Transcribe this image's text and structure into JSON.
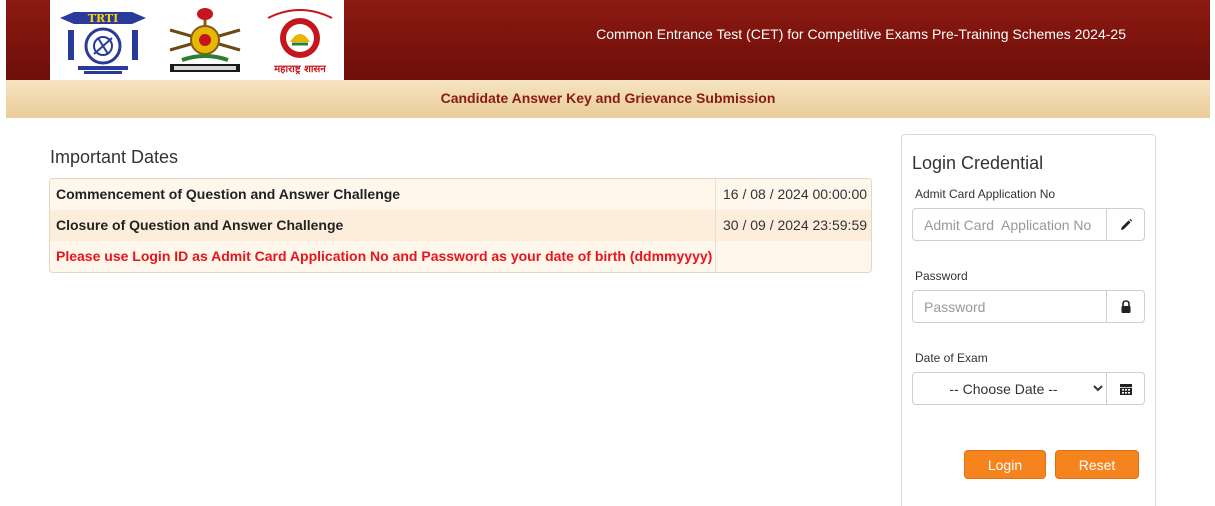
{
  "header": {
    "title": "Common Entrance Test (CET) for Competitive Exams Pre-Training Schemes 2024-25",
    "logos": {
      "trti": {
        "name": "trti-logo",
        "text": "TRTI"
      },
      "emblem": {
        "name": "tribal-emblem-logo"
      },
      "maharashtra": {
        "name": "maharashtra-govt-logo",
        "text": "महाराष्ट्र शासन"
      }
    }
  },
  "subbar": {
    "title": "Candidate Answer Key and Grievance Submission"
  },
  "dates": {
    "heading": "Important Dates",
    "rows": [
      {
        "label": "Commencement of Question and Answer Challenge",
        "value": "16 / 08 / 2024 00:00:00"
      },
      {
        "label": "Closure of Question and Answer Challenge",
        "value": "30 / 09 / 2024 23:59:59"
      }
    ],
    "note": "Please use Login ID as Admit Card Application No and Password as your date of birth (ddmmyyyy)"
  },
  "login": {
    "title": "Login Credential",
    "application_label": "Admit Card Application No",
    "application_placeholder": "Admit Card  Application No",
    "password_label": "Password",
    "password_placeholder": "Password",
    "exam_date_label": "Date of Exam",
    "exam_date_selected": "-- Choose Date --",
    "login_button": "Login",
    "reset_button": "Reset",
    "icons": {
      "application": "pencil-icon",
      "password": "lock-icon",
      "exam_date": "calendar-icon"
    }
  },
  "colors": {
    "header_bg": "#7a120c",
    "subbar_bg": "#efd7ad",
    "subbar_text": "#8b1a12",
    "note_text": "#e8141b",
    "button_bg": "#f5841f"
  }
}
